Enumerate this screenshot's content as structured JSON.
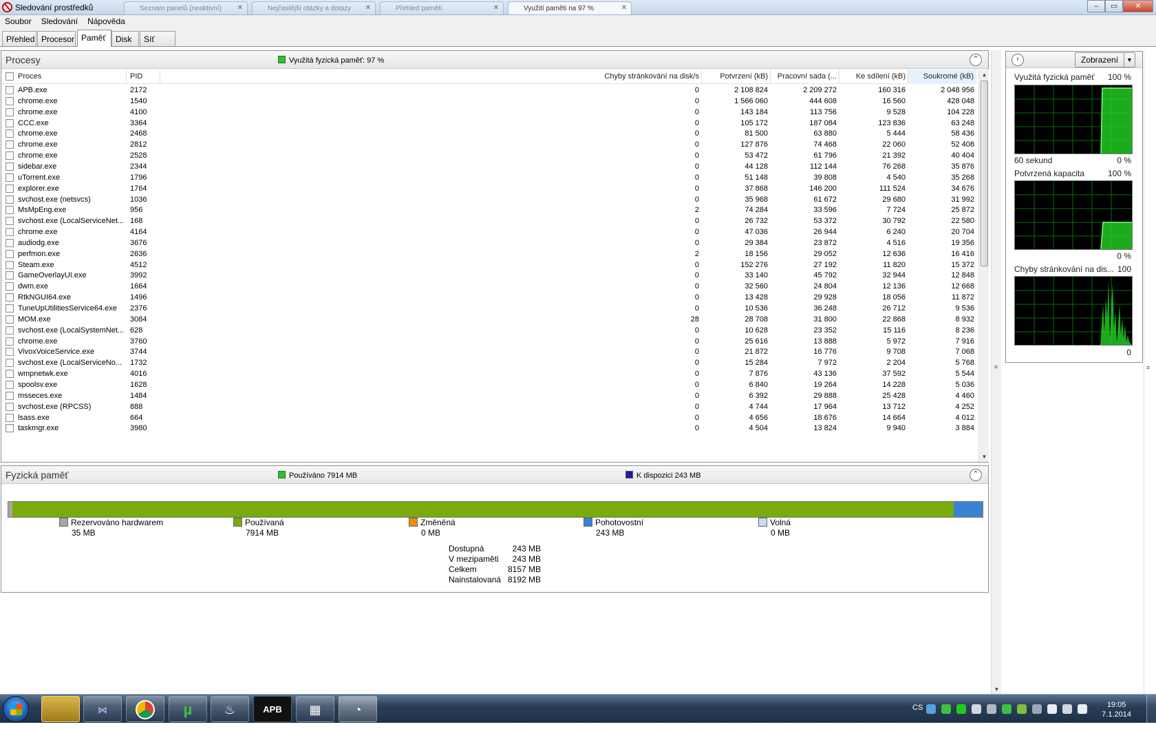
{
  "window": {
    "title": "Sledování prostředků",
    "bg_tabs": [
      "Seznam panelů (neaktivní)",
      "Nejčastější otázky a dotazy",
      "Přehled paměti",
      "Využití paměti na 97 %"
    ],
    "controls": {
      "minimize": "–",
      "maximize": "▭",
      "close": "✕"
    }
  },
  "menu": [
    "Soubor",
    "Sledování",
    "Nápověda"
  ],
  "tabs": [
    "Přehled",
    "Procesor",
    "Paměť",
    "Disk",
    "Síť"
  ],
  "selected_tab": "Paměť",
  "processes": {
    "title": "Procesy",
    "indicator": "Využitá fyzická paměť: 97 %",
    "indicator_color": "#22c922",
    "columns": {
      "proc": "Proces",
      "pid": "PID",
      "faults": "Chyby stránkování na disk/s",
      "commit": "Potvrzení (kB)",
      "ws": "Pracovní sada (...",
      "shared": "Ke sdílení (kB)",
      "priv": "Soukromé (kB)"
    },
    "rows": [
      {
        "proc": "APB.exe",
        "pid": "2172",
        "faults": "0",
        "commit": "2 108 824",
        "ws": "2 209 272",
        "shared": "160 316",
        "priv": "2 048 956"
      },
      {
        "proc": "chrome.exe",
        "pid": "1540",
        "faults": "0",
        "commit": "1 566 060",
        "ws": "444 608",
        "shared": "16 560",
        "priv": "428 048"
      },
      {
        "proc": "chrome.exe",
        "pid": "4100",
        "faults": "0",
        "commit": "143 184",
        "ws": "113 756",
        "shared": "9 528",
        "priv": "104 228"
      },
      {
        "proc": "CCC.exe",
        "pid": "3364",
        "faults": "0",
        "commit": "105 172",
        "ws": "187 084",
        "shared": "123 836",
        "priv": "63 248"
      },
      {
        "proc": "chrome.exe",
        "pid": "2468",
        "faults": "0",
        "commit": "81 500",
        "ws": "63 880",
        "shared": "5 444",
        "priv": "58 436"
      },
      {
        "proc": "chrome.exe",
        "pid": "2812",
        "faults": "0",
        "commit": "127 876",
        "ws": "74 468",
        "shared": "22 060",
        "priv": "52 408"
      },
      {
        "proc": "chrome.exe",
        "pid": "2528",
        "faults": "0",
        "commit": "53 472",
        "ws": "61 796",
        "shared": "21 392",
        "priv": "40 404"
      },
      {
        "proc": "sidebar.exe",
        "pid": "2344",
        "faults": "0",
        "commit": "44 128",
        "ws": "112 144",
        "shared": "76 268",
        "priv": "35 876"
      },
      {
        "proc": "uTorrent.exe",
        "pid": "1796",
        "faults": "0",
        "commit": "51 148",
        "ws": "39 808",
        "shared": "4 540",
        "priv": "35 268"
      },
      {
        "proc": "explorer.exe",
        "pid": "1764",
        "faults": "0",
        "commit": "37 868",
        "ws": "146 200",
        "shared": "111 524",
        "priv": "34 676"
      },
      {
        "proc": "svchost.exe (netsvcs)",
        "pid": "1036",
        "faults": "0",
        "commit": "35 968",
        "ws": "61 672",
        "shared": "29 680",
        "priv": "31 992"
      },
      {
        "proc": "MsMpEng.exe",
        "pid": "956",
        "faults": "2",
        "commit": "74 284",
        "ws": "33 596",
        "shared": "7 724",
        "priv": "25 872"
      },
      {
        "proc": "svchost.exe (LocalServiceNet...",
        "pid": "168",
        "faults": "0",
        "commit": "26 732",
        "ws": "53 372",
        "shared": "30 792",
        "priv": "22 580"
      },
      {
        "proc": "chrome.exe",
        "pid": "4164",
        "faults": "0",
        "commit": "47 036",
        "ws": "26 944",
        "shared": "6 240",
        "priv": "20 704"
      },
      {
        "proc": "audiodg.exe",
        "pid": "3676",
        "faults": "0",
        "commit": "29 384",
        "ws": "23 872",
        "shared": "4 516",
        "priv": "19 356"
      },
      {
        "proc": "perfmon.exe",
        "pid": "2636",
        "faults": "2",
        "commit": "18 156",
        "ws": "29 052",
        "shared": "12 636",
        "priv": "16 416"
      },
      {
        "proc": "Steam.exe",
        "pid": "4512",
        "faults": "0",
        "commit": "152 276",
        "ws": "27 192",
        "shared": "11 820",
        "priv": "15 372"
      },
      {
        "proc": "GameOverlayUI.exe",
        "pid": "3992",
        "faults": "0",
        "commit": "33 140",
        "ws": "45 792",
        "shared": "32 944",
        "priv": "12 848"
      },
      {
        "proc": "dwm.exe",
        "pid": "1664",
        "faults": "0",
        "commit": "32 560",
        "ws": "24 804",
        "shared": "12 136",
        "priv": "12 668"
      },
      {
        "proc": "RtkNGUI64.exe",
        "pid": "1496",
        "faults": "0",
        "commit": "13 428",
        "ws": "29 928",
        "shared": "18 056",
        "priv": "11 872"
      },
      {
        "proc": "TuneUpUtilitiesService64.exe",
        "pid": "2376",
        "faults": "0",
        "commit": "10 536",
        "ws": "36 248",
        "shared": "26 712",
        "priv": "9 536"
      },
      {
        "proc": "MOM.exe",
        "pid": "3084",
        "faults": "28",
        "commit": "28 708",
        "ws": "31 800",
        "shared": "22 868",
        "priv": "8 932"
      },
      {
        "proc": "svchost.exe (LocalSystemNet...",
        "pid": "628",
        "faults": "0",
        "commit": "10 628",
        "ws": "23 352",
        "shared": "15 116",
        "priv": "8 236"
      },
      {
        "proc": "chrome.exe",
        "pid": "3760",
        "faults": "0",
        "commit": "25 616",
        "ws": "13 888",
        "shared": "5 972",
        "priv": "7 916"
      },
      {
        "proc": "VivoxVoiceService.exe",
        "pid": "3744",
        "faults": "0",
        "commit": "21 872",
        "ws": "16 776",
        "shared": "9 708",
        "priv": "7 068"
      },
      {
        "proc": "svchost.exe (LocalServiceNo...",
        "pid": "1732",
        "faults": "0",
        "commit": "15 284",
        "ws": "7 972",
        "shared": "2 204",
        "priv": "5 768"
      },
      {
        "proc": "wmpnetwk.exe",
        "pid": "4016",
        "faults": "0",
        "commit": "7 876",
        "ws": "43 136",
        "shared": "37 592",
        "priv": "5 544"
      },
      {
        "proc": "spoolsv.exe",
        "pid": "1628",
        "faults": "0",
        "commit": "6 840",
        "ws": "19 264",
        "shared": "14 228",
        "priv": "5 036"
      },
      {
        "proc": "msseces.exe",
        "pid": "1484",
        "faults": "0",
        "commit": "6 392",
        "ws": "29 888",
        "shared": "25 428",
        "priv": "4 460"
      },
      {
        "proc": "svchost.exe (RPCSS)",
        "pid": "888",
        "faults": "0",
        "commit": "4 744",
        "ws": "17 964",
        "shared": "13 712",
        "priv": "4 252"
      },
      {
        "proc": "lsass.exe",
        "pid": "664",
        "faults": "0",
        "commit": "4 656",
        "ws": "18 676",
        "shared": "14 664",
        "priv": "4 012"
      },
      {
        "proc": "taskmgr.exe",
        "pid": "3980",
        "faults": "0",
        "commit": "4 504",
        "ws": "13 824",
        "shared": "9 940",
        "priv": "3 884"
      }
    ]
  },
  "physical": {
    "title": "Fyzická paměť",
    "used_label": "Používáno 7914 MB",
    "used_color": "#22c922",
    "avail_label": "K dispozici 243 MB",
    "avail_color": "#1a1aa6",
    "bar_mb": {
      "reserved": 35,
      "used": 7914,
      "modified": 0,
      "standby": 243,
      "free": 0
    },
    "legend": [
      {
        "name": "Rezervováno hardwarem",
        "value": "35 MB",
        "color": "#a6a6a6"
      },
      {
        "name": "Používaná",
        "value": "7914 MB",
        "color": "#7aab0c"
      },
      {
        "name": "Změněná",
        "value": "0 MB",
        "color": "#f08c00"
      },
      {
        "name": "Pohotovostní",
        "value": "243 MB",
        "color": "#3c82d2"
      },
      {
        "name": "Volná",
        "value": "0 MB",
        "color": "#c8dcf5"
      }
    ],
    "stats": [
      {
        "label": "Dostupná",
        "value": "243 MB"
      },
      {
        "label": "V mezipaměti",
        "value": "243 MB"
      },
      {
        "label": "Celkem",
        "value": "8157 MB"
      },
      {
        "label": "Nainstalovaná",
        "value": "8192 MB"
      }
    ]
  },
  "right_panel": {
    "view_button": "Zobrazení",
    "graphs": [
      {
        "title": "Využitá fyzická paměť",
        "top": "100 %",
        "bottom_left": "60 sekund",
        "bottom": "0 %"
      },
      {
        "title": "Potvrzená kapacita",
        "top": "100 %",
        "bottom": "0 %"
      },
      {
        "title": "Chyby stránkování na dis...",
        "top": "100",
        "bottom": "0"
      }
    ]
  },
  "taskbar": {
    "apps": [
      "explorer-icon",
      "visual-studio-icon",
      "chrome-icon",
      "utorrent-icon",
      "steam-icon",
      "apb-icon",
      "resource-monitor-icon",
      "perfmon-icon"
    ],
    "apb_text": "APB",
    "lang": "CS",
    "time": "19:05",
    "date": "7.1.2014"
  }
}
